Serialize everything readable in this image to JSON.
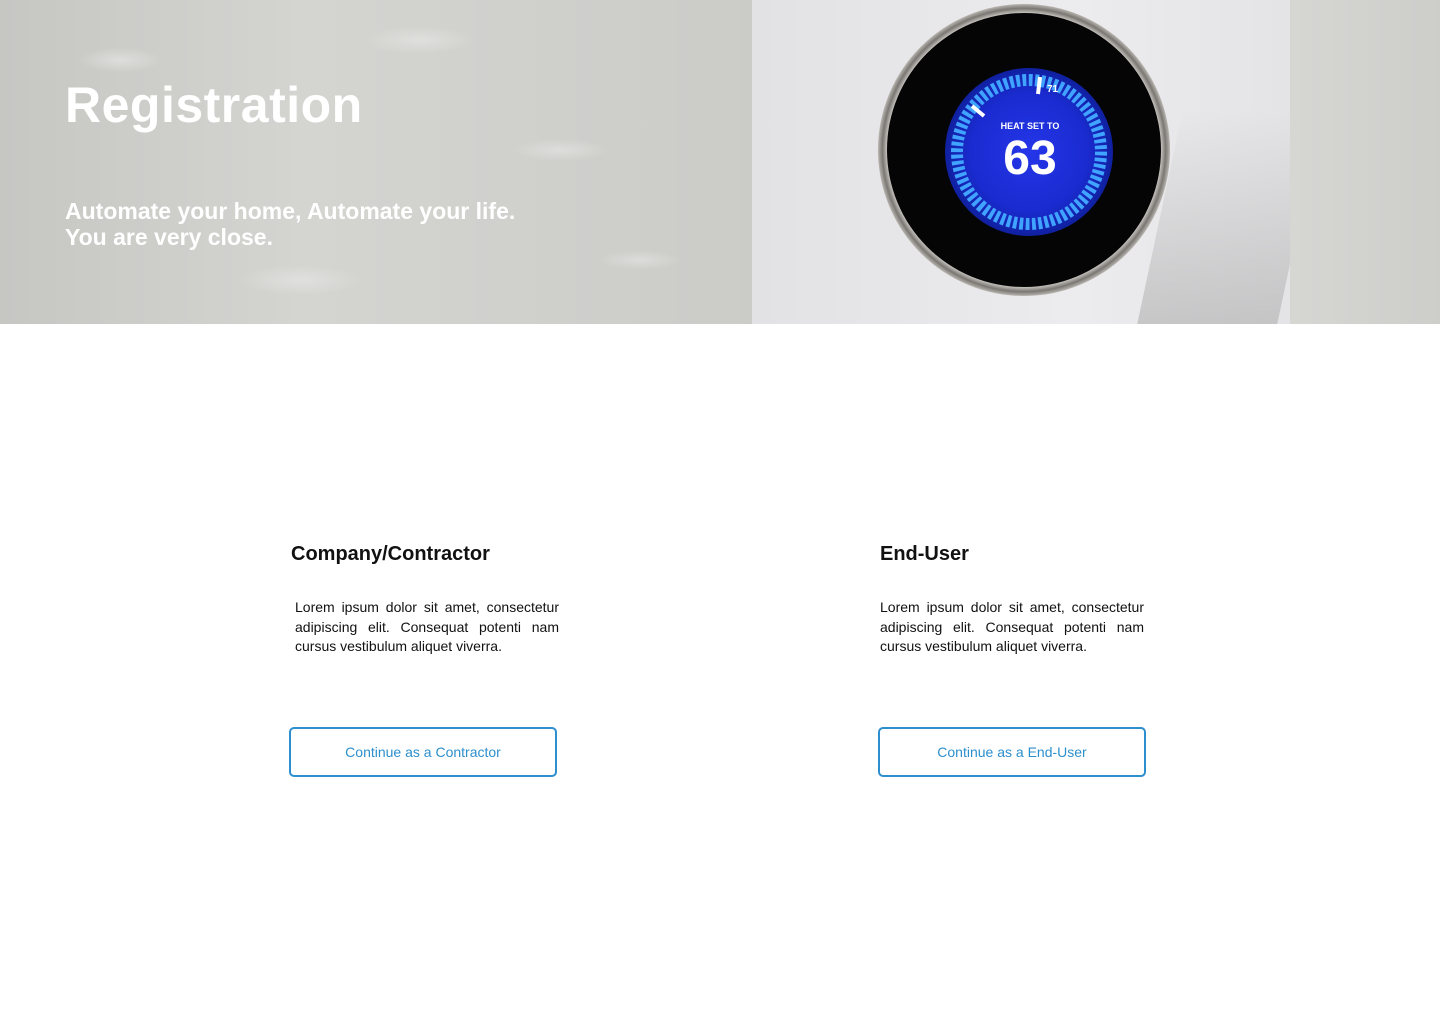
{
  "hero": {
    "title": "Registration",
    "subtitle": "Automate your home, Automate your life. You are very close.",
    "thermostat": {
      "label": "HEAT SET TO",
      "temperature": "63",
      "outdoor": "71"
    }
  },
  "cards": [
    {
      "title": "Company/Contractor",
      "description": "Lorem ipsum dolor sit amet, consectetur adipiscing elit. Consequat potenti nam cursus vestibulum aliquet viverra.",
      "button_label": "Continue as a Contractor"
    },
    {
      "title": "End-User",
      "description": "Lorem ipsum dolor sit amet, consectetur adipiscing elit. Consequat potenti nam cursus vestibulum aliquet viverra.",
      "button_label": "Continue as a End-User"
    }
  ],
  "colors": {
    "accent": "#2d8fcd",
    "thermostat_display": "#1a2fd6",
    "text": "#111111"
  }
}
